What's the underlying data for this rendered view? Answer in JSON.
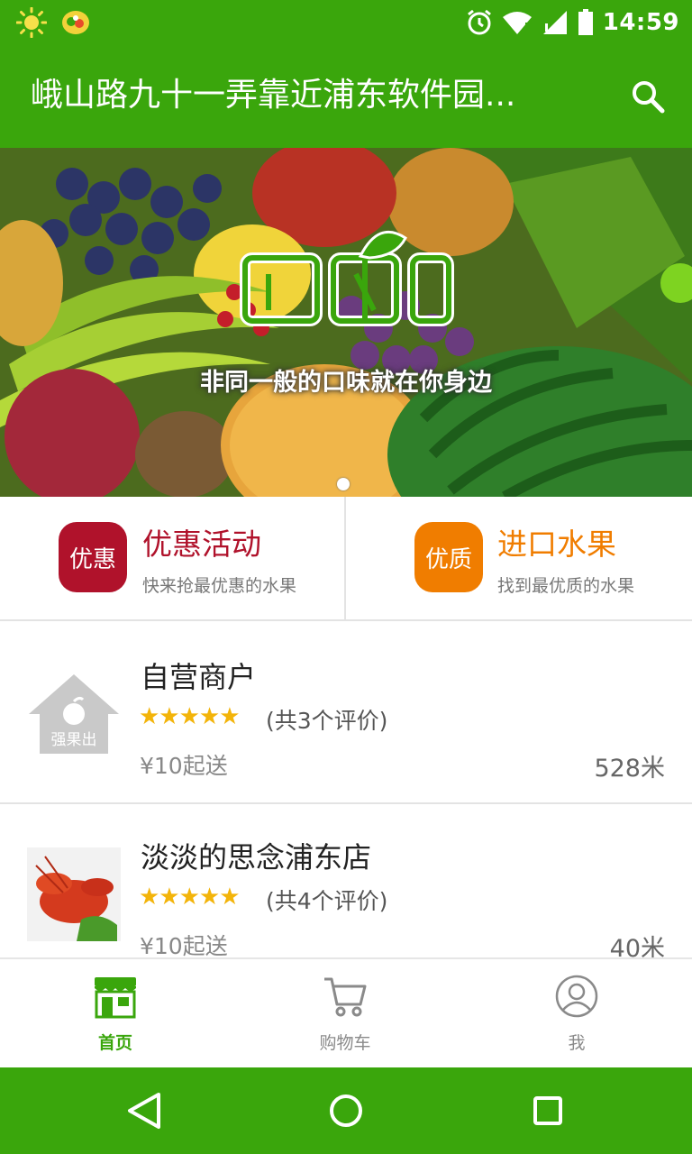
{
  "status_bar": {
    "time": "14:59",
    "icons": [
      "sun-icon",
      "app-badge-icon",
      "alarm-icon",
      "wifi-icon",
      "signal-icon",
      "battery-icon"
    ]
  },
  "app_bar": {
    "title": "峨山路九十一弄靠近浦东软件园...",
    "search_icon": "search-icon"
  },
  "banner": {
    "logo_text": "强果出",
    "tagline": "非同一般的口味就在你身边"
  },
  "promos": [
    {
      "badge": "优惠",
      "title": "优惠活动",
      "subtitle": "快来抢最优惠的水果",
      "color": "#b0122b"
    },
    {
      "badge": "优质",
      "title": "进口水果",
      "subtitle": "找到最优质的水果",
      "color": "#f07d00"
    }
  ],
  "shops": [
    {
      "name": "自营商户",
      "stars": "★★★★★",
      "reviews": "(共3个评价)",
      "min_order": "¥10起送",
      "distance": "528米",
      "thumb_label": "强果出"
    },
    {
      "name": "淡淡的思念浦东店",
      "stars": "★★★★★",
      "reviews": "(共4个评价)",
      "min_order": "¥10起送",
      "distance": "40米"
    }
  ],
  "bottom_nav": [
    {
      "label": "首页",
      "icon": "store-icon",
      "active": true
    },
    {
      "label": "购物车",
      "icon": "cart-icon",
      "active": false
    },
    {
      "label": "我",
      "icon": "person-icon",
      "active": false
    }
  ],
  "colors": {
    "brand_green": "#3aa60c",
    "promo_red": "#b0122b",
    "promo_orange": "#f07d00",
    "star_yellow": "#f3b40a"
  }
}
